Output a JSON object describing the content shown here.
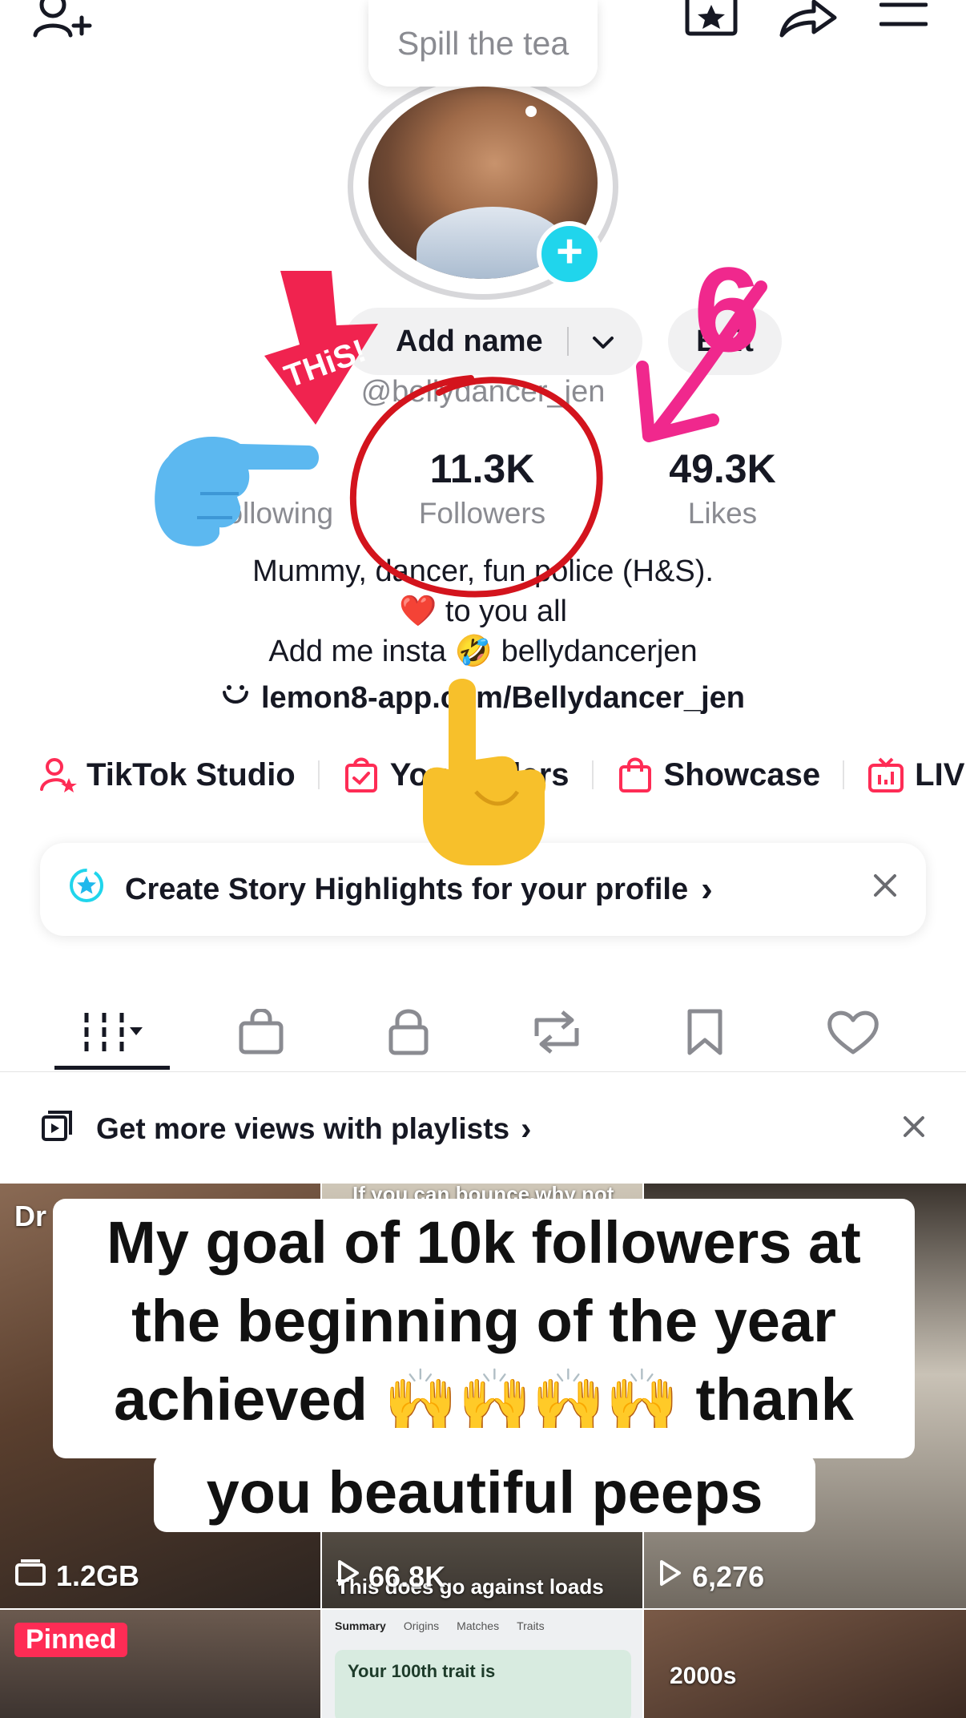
{
  "bubble": {
    "text": "Spill the tea"
  },
  "profile": {
    "name_button": "Add name",
    "edit_button": "Edit",
    "handle": "@bellydancer_jen",
    "stats": {
      "following_label": "Following",
      "followers_value": "11.3K",
      "followers_label": "Followers",
      "likes_value": "49.3K",
      "likes_label": "Likes"
    },
    "bio": {
      "line1": "Mummy, dancer, fun police (H&S).",
      "line2": "❤️ to you all",
      "line3": "Add me insta 🤣 bellydancerjen",
      "link": "lemon8-app.com/Bellydancer_jen"
    }
  },
  "tools": [
    {
      "label": "TikTok Studio",
      "icon": "person-star-icon"
    },
    {
      "label": "Your orders",
      "icon": "clipboard-bag-icon"
    },
    {
      "label": "Showcase",
      "icon": "shopping-bag-icon"
    },
    {
      "label": "LIVE",
      "icon": "live-tv-icon"
    }
  ],
  "story_card": {
    "text": "Create Story Highlights for your profile",
    "chevron": "›"
  },
  "tabs": [
    "videos-tab",
    "shop-tab",
    "private-tab",
    "reposts-tab",
    "saved-tab",
    "liked-tab"
  ],
  "playlist_bar": {
    "text": "Get more views with playlists",
    "chevron": "›"
  },
  "videos": {
    "cell1_label": "1.2GB",
    "cell1_tag": "Dr",
    "cell2_views": "66.8K",
    "cell2_caption_top": "If you can bounce,why not",
    "cell2_caption_bottom": "This does go against loads",
    "cell3_views": "6,276",
    "pinned": "Pinned",
    "cell5_tabs": [
      "Summary",
      "Origins",
      "Matches",
      "Traits"
    ],
    "cell5_card": "Your 100th trait is",
    "cell6_caption": "2000s"
  },
  "overlay_text": {
    "line1": "My goal of 10k followers at",
    "line2": "the beginning of the year",
    "line3": "achieved 🙌🙌🙌🙌 thank",
    "line4": "you beautiful peeps"
  },
  "stickers": {
    "this_arrow": "THiS!",
    "number": "6"
  },
  "colors": {
    "accent": "#fe2c55",
    "plus": "#20d5ec",
    "text": "#161823",
    "muted": "#8a8b91"
  }
}
